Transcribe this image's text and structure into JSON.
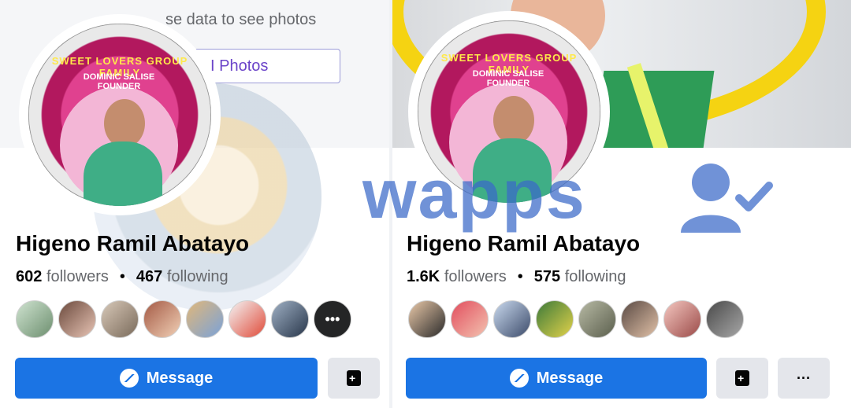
{
  "left_profile": {
    "cover_hint": "se data to see photos",
    "photos_button_label": "I Photos",
    "name": "Higeno Ramil Abatayo",
    "followers_count": "602",
    "followers_label": "followers",
    "separator": "•",
    "following_count": "467",
    "following_label": "following",
    "more_friends_label": "•••",
    "message_label": "Message",
    "avatar_ring_text": "SWEET LOVERS GROUP FAMILY",
    "avatar_ring_text2": "DOMINIC SALISE FOUNDER"
  },
  "right_profile": {
    "name": "Higeno Ramil Abatayo",
    "followers_count": "1.6K",
    "followers_label": "followers",
    "separator": "•",
    "following_count": "575",
    "following_label": "following",
    "message_label": "Message",
    "more_label": "···",
    "avatar_ring_text": "SWEET LOVERS GROUP FAMILY",
    "avatar_ring_text2": "DOMINIC SALISE FOUNDER"
  },
  "watermark": {
    "text": "wapps"
  },
  "colors": {
    "primary_button": "#1b74e4",
    "secondary_button": "#e4e6eb",
    "watermark": "#3a69c9"
  },
  "icons": [
    "messenger-icon",
    "save-icon",
    "more-icon",
    "person-check-icon"
  ]
}
